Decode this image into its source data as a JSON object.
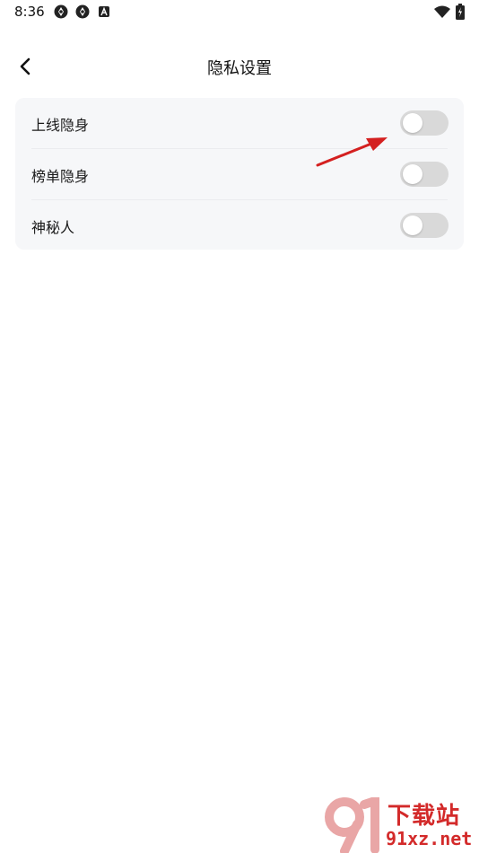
{
  "status_bar": {
    "time": "8:36",
    "icons": [
      "app-notification-icon",
      "app-notification-icon",
      "a-badge-icon",
      "wifi-icon",
      "battery-charging-icon"
    ]
  },
  "header": {
    "back_icon": "chevron-left-icon",
    "title": "隐私设置"
  },
  "settings": {
    "items": [
      {
        "label": "上线隐身",
        "enabled": false
      },
      {
        "label": "榜单隐身",
        "enabled": false
      },
      {
        "label": "神秘人",
        "enabled": false
      }
    ]
  },
  "watermark": {
    "brand": "下载站",
    "domain": "91xz.net"
  },
  "colors": {
    "background": "#ffffff",
    "card": "#f6f7f9",
    "toggle_off": "#d9d9d9",
    "annotation_arrow": "#d42020",
    "watermark": "#d32a2a"
  }
}
